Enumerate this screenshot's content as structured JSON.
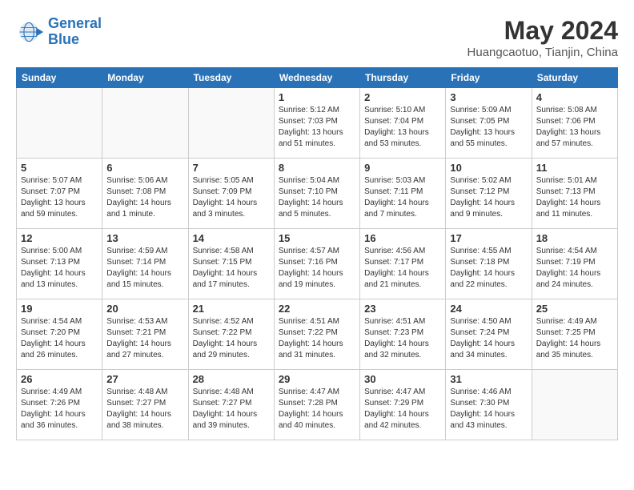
{
  "logo": {
    "line1": "General",
    "line2": "Blue"
  },
  "title": "May 2024",
  "location": "Huangcaotuo, Tianjin, China",
  "days_of_week": [
    "Sunday",
    "Monday",
    "Tuesday",
    "Wednesday",
    "Thursday",
    "Friday",
    "Saturday"
  ],
  "weeks": [
    [
      {
        "day": "",
        "text": "",
        "empty": true
      },
      {
        "day": "",
        "text": "",
        "empty": true
      },
      {
        "day": "",
        "text": "",
        "empty": true
      },
      {
        "day": "1",
        "text": "Sunrise: 5:12 AM\nSunset: 7:03 PM\nDaylight: 13 hours\nand 51 minutes."
      },
      {
        "day": "2",
        "text": "Sunrise: 5:10 AM\nSunset: 7:04 PM\nDaylight: 13 hours\nand 53 minutes."
      },
      {
        "day": "3",
        "text": "Sunrise: 5:09 AM\nSunset: 7:05 PM\nDaylight: 13 hours\nand 55 minutes."
      },
      {
        "day": "4",
        "text": "Sunrise: 5:08 AM\nSunset: 7:06 PM\nDaylight: 13 hours\nand 57 minutes."
      }
    ],
    [
      {
        "day": "5",
        "text": "Sunrise: 5:07 AM\nSunset: 7:07 PM\nDaylight: 13 hours\nand 59 minutes."
      },
      {
        "day": "6",
        "text": "Sunrise: 5:06 AM\nSunset: 7:08 PM\nDaylight: 14 hours\nand 1 minute."
      },
      {
        "day": "7",
        "text": "Sunrise: 5:05 AM\nSunset: 7:09 PM\nDaylight: 14 hours\nand 3 minutes."
      },
      {
        "day": "8",
        "text": "Sunrise: 5:04 AM\nSunset: 7:10 PM\nDaylight: 14 hours\nand 5 minutes."
      },
      {
        "day": "9",
        "text": "Sunrise: 5:03 AM\nSunset: 7:11 PM\nDaylight: 14 hours\nand 7 minutes."
      },
      {
        "day": "10",
        "text": "Sunrise: 5:02 AM\nSunset: 7:12 PM\nDaylight: 14 hours\nand 9 minutes."
      },
      {
        "day": "11",
        "text": "Sunrise: 5:01 AM\nSunset: 7:13 PM\nDaylight: 14 hours\nand 11 minutes."
      }
    ],
    [
      {
        "day": "12",
        "text": "Sunrise: 5:00 AM\nSunset: 7:13 PM\nDaylight: 14 hours\nand 13 minutes."
      },
      {
        "day": "13",
        "text": "Sunrise: 4:59 AM\nSunset: 7:14 PM\nDaylight: 14 hours\nand 15 minutes."
      },
      {
        "day": "14",
        "text": "Sunrise: 4:58 AM\nSunset: 7:15 PM\nDaylight: 14 hours\nand 17 minutes."
      },
      {
        "day": "15",
        "text": "Sunrise: 4:57 AM\nSunset: 7:16 PM\nDaylight: 14 hours\nand 19 minutes."
      },
      {
        "day": "16",
        "text": "Sunrise: 4:56 AM\nSunset: 7:17 PM\nDaylight: 14 hours\nand 21 minutes."
      },
      {
        "day": "17",
        "text": "Sunrise: 4:55 AM\nSunset: 7:18 PM\nDaylight: 14 hours\nand 22 minutes."
      },
      {
        "day": "18",
        "text": "Sunrise: 4:54 AM\nSunset: 7:19 PM\nDaylight: 14 hours\nand 24 minutes."
      }
    ],
    [
      {
        "day": "19",
        "text": "Sunrise: 4:54 AM\nSunset: 7:20 PM\nDaylight: 14 hours\nand 26 minutes."
      },
      {
        "day": "20",
        "text": "Sunrise: 4:53 AM\nSunset: 7:21 PM\nDaylight: 14 hours\nand 27 minutes."
      },
      {
        "day": "21",
        "text": "Sunrise: 4:52 AM\nSunset: 7:22 PM\nDaylight: 14 hours\nand 29 minutes."
      },
      {
        "day": "22",
        "text": "Sunrise: 4:51 AM\nSunset: 7:22 PM\nDaylight: 14 hours\nand 31 minutes."
      },
      {
        "day": "23",
        "text": "Sunrise: 4:51 AM\nSunset: 7:23 PM\nDaylight: 14 hours\nand 32 minutes."
      },
      {
        "day": "24",
        "text": "Sunrise: 4:50 AM\nSunset: 7:24 PM\nDaylight: 14 hours\nand 34 minutes."
      },
      {
        "day": "25",
        "text": "Sunrise: 4:49 AM\nSunset: 7:25 PM\nDaylight: 14 hours\nand 35 minutes."
      }
    ],
    [
      {
        "day": "26",
        "text": "Sunrise: 4:49 AM\nSunset: 7:26 PM\nDaylight: 14 hours\nand 36 minutes."
      },
      {
        "day": "27",
        "text": "Sunrise: 4:48 AM\nSunset: 7:27 PM\nDaylight: 14 hours\nand 38 minutes."
      },
      {
        "day": "28",
        "text": "Sunrise: 4:48 AM\nSunset: 7:27 PM\nDaylight: 14 hours\nand 39 minutes."
      },
      {
        "day": "29",
        "text": "Sunrise: 4:47 AM\nSunset: 7:28 PM\nDaylight: 14 hours\nand 40 minutes."
      },
      {
        "day": "30",
        "text": "Sunrise: 4:47 AM\nSunset: 7:29 PM\nDaylight: 14 hours\nand 42 minutes."
      },
      {
        "day": "31",
        "text": "Sunrise: 4:46 AM\nSunset: 7:30 PM\nDaylight: 14 hours\nand 43 minutes."
      },
      {
        "day": "",
        "text": "",
        "empty": true
      }
    ]
  ]
}
